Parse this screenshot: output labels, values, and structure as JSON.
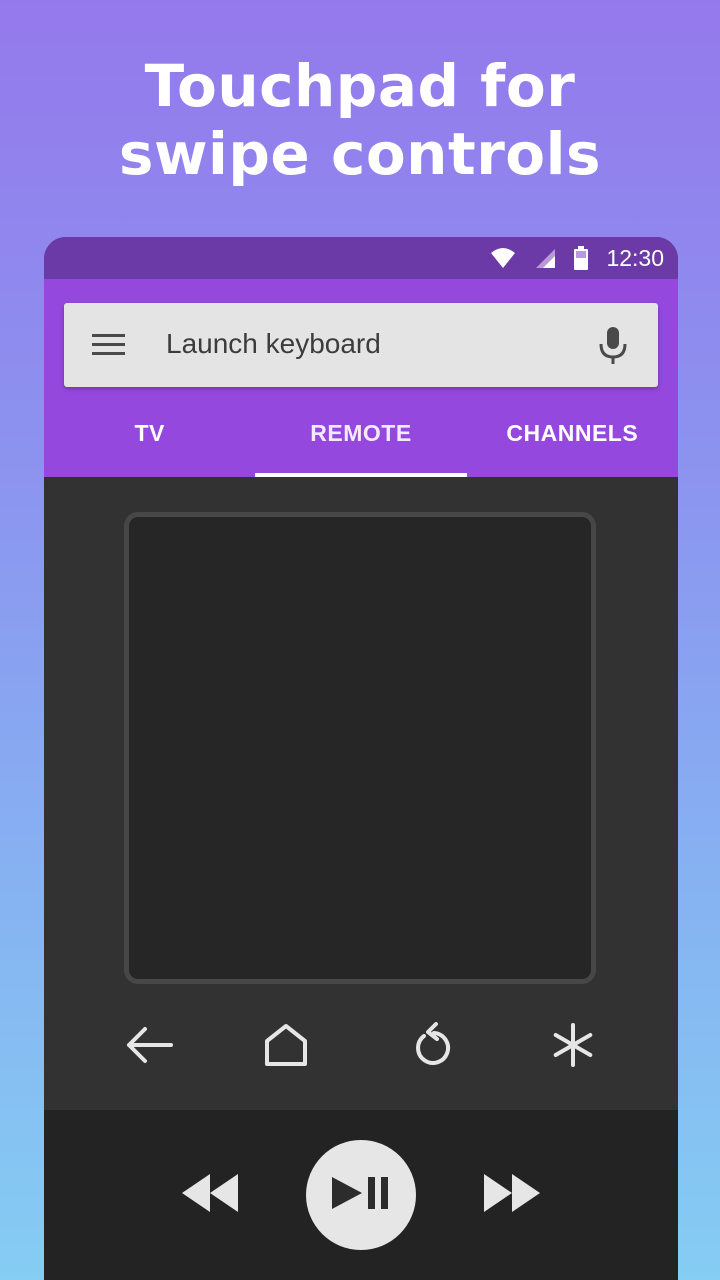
{
  "headline": {
    "line1": "Touchpad for",
    "line2": "swipe controls"
  },
  "status_bar": {
    "time": "12:30",
    "icons": [
      "wifi-icon",
      "signal-icon",
      "battery-icon"
    ]
  },
  "search": {
    "placeholder": "Launch keyboard",
    "menu_icon": "menu-icon",
    "mic_icon": "mic-icon"
  },
  "tabs": [
    {
      "label": "TV",
      "active": false
    },
    {
      "label": "REMOTE",
      "active": true
    },
    {
      "label": "CHANNELS",
      "active": false
    }
  ],
  "nav_buttons": [
    "back-icon",
    "home-icon",
    "replay-icon",
    "options-icon"
  ],
  "media_buttons": [
    "rewind-icon",
    "play-pause-icon",
    "fast-forward-icon"
  ],
  "colors": {
    "status_bar": "#6b3aa6",
    "app_bar": "#9548dd",
    "remote_bg": "#323232",
    "touchpad_bg": "#262626",
    "media_bar": "#232323"
  }
}
